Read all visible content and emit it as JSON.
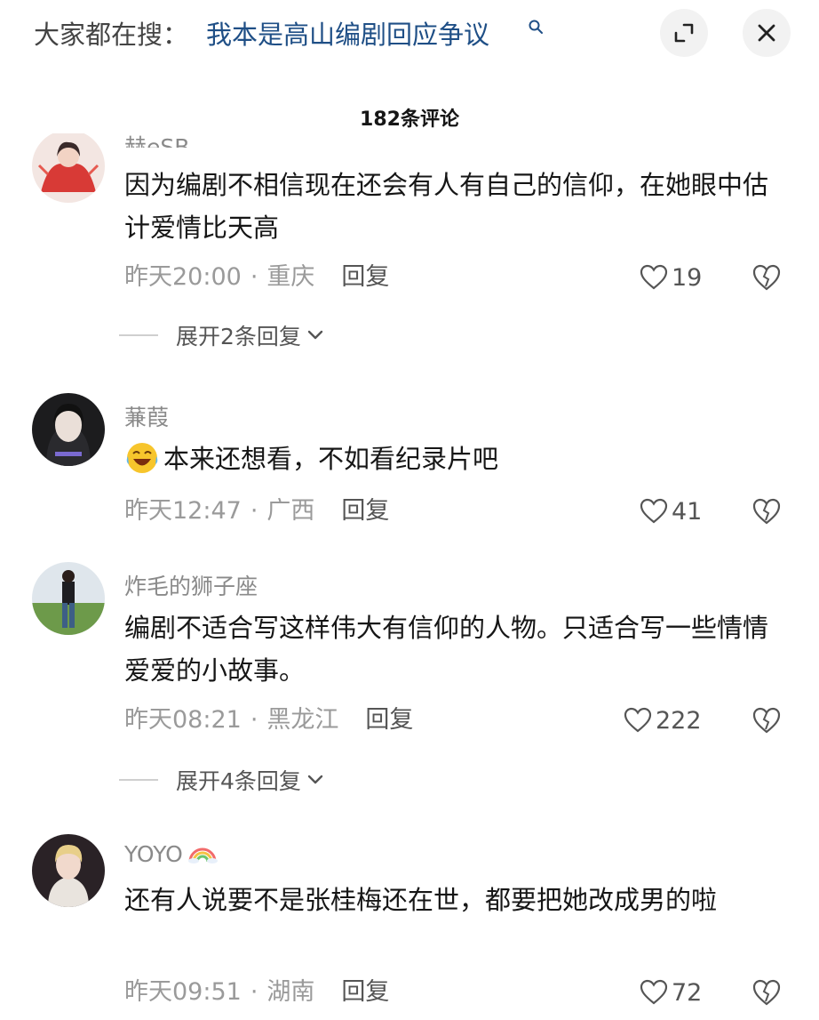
{
  "header": {
    "search_prefix": "大家都在搜：",
    "search_query": "我本是高山编剧回应争议",
    "search_icon": "magnifier-icon",
    "expand_icon": "fullscreen-icon",
    "close_icon": "close-icon"
  },
  "comments_title": "182条评论",
  "comments": [
    {
      "username": "赫eSB...",
      "content": "因为编剧不相信现在还会有人有自己的信仰，在她眼中估计爱情比天高",
      "time": "昨天20:00",
      "location": "重庆",
      "reply_label": "回复",
      "likes": "19",
      "expand_label": "展开2条回复"
    },
    {
      "username": "蒹葭",
      "content": "本来还想看，不如看纪录片吧",
      "emoji": "laughing-crying-emoji",
      "time": "昨天12:47",
      "location": "广西",
      "reply_label": "回复",
      "likes": "41"
    },
    {
      "username": "炸毛的狮子座",
      "content": "编剧不适合写这样伟大有信仰的人物。只适合写一些情情爱爱的小故事。",
      "time": "昨天08:21",
      "location": "黑龙江",
      "reply_label": "回复",
      "likes": "222",
      "expand_label": "展开4条回复"
    },
    {
      "username": "YOYO",
      "username_badge": "rainbow-icon",
      "content": "还有人说要不是张桂梅还在世，都要把她改成男的啦",
      "time": "昨天09:51",
      "location": "湖南",
      "reply_label": "回复",
      "likes": "72"
    }
  ],
  "colors": {
    "link_blue": "#1f4f86",
    "meta_gray": "#9a9a9a",
    "text": "#161616"
  }
}
